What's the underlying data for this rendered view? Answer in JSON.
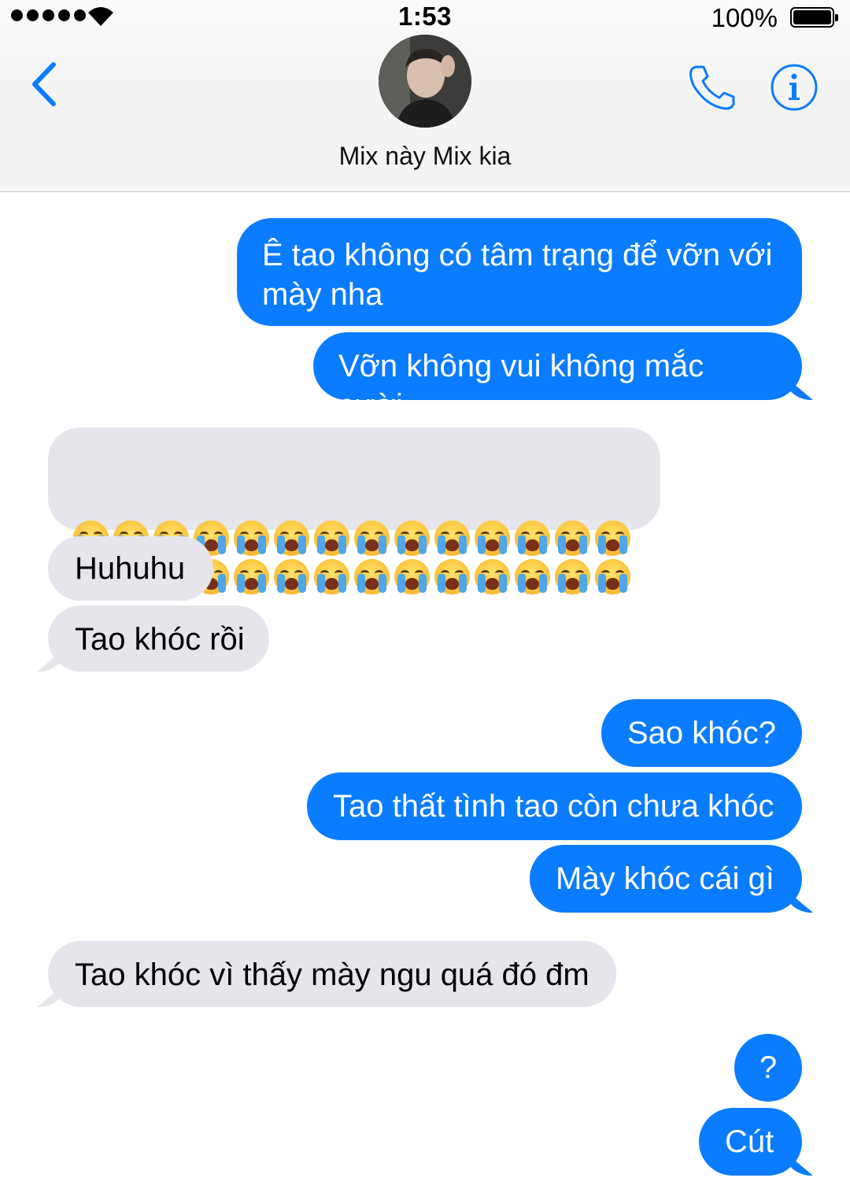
{
  "status_bar": {
    "time": "1:53",
    "battery_percent": "100%",
    "signal_bars_filled": 5,
    "wifi": true
  },
  "header": {
    "contact_name": "Mix này Mix kia",
    "back_icon": "chevron-left-icon",
    "call_icon": "phone-icon",
    "info_icon": "info-icon"
  },
  "messages": [
    {
      "from": "me",
      "text": "Ê tao không có tâm trạng để vỡn với\nmày nha"
    },
    {
      "from": "me",
      "text": "Vỡn không vui không mắc cười"
    },
    {
      "from": "them",
      "type": "emoji",
      "emoji": "loudly-crying-face",
      "count": 28
    },
    {
      "from": "them",
      "text": "Huhuhu"
    },
    {
      "from": "them",
      "text": "Tao khóc rồi"
    },
    {
      "from": "me",
      "text": "Sao khóc?"
    },
    {
      "from": "me",
      "text": "Tao thất tình tao còn chưa khóc"
    },
    {
      "from": "me",
      "text": "Mày khóc cái gì"
    },
    {
      "from": "them",
      "text": "Tao khóc vì thấy mày ngu quá đó đm"
    },
    {
      "from": "me",
      "text": "?"
    },
    {
      "from": "me",
      "text": "Cút"
    }
  ],
  "colors": {
    "accent": "#0a7cff",
    "sent_bubble": "#0a7cff",
    "received_bubble": "#e6e5eb",
    "header_bg": "#f5f5f5"
  }
}
